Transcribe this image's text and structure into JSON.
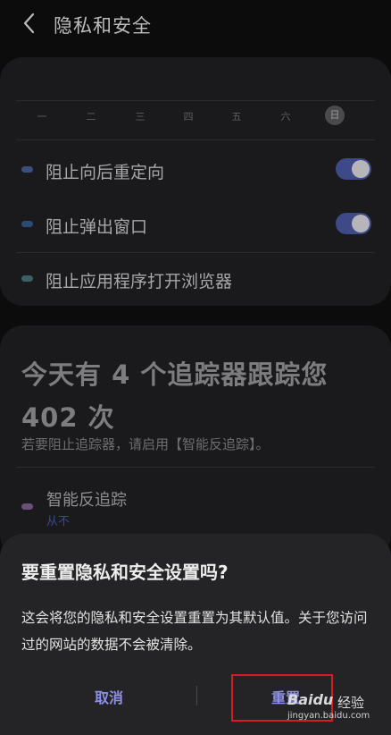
{
  "header": {
    "title": "隐私和安全"
  },
  "calendar": {
    "days": [
      "一",
      "二",
      "三",
      "四",
      "五",
      "六",
      "日"
    ],
    "today_index": 6
  },
  "settings": [
    {
      "label": "阻止向后重定向",
      "toggle": true,
      "dot_color": "#3a4f7a"
    },
    {
      "label": "阻止弹出窗口",
      "toggle": true,
      "dot_color": "#2e4a72"
    },
    {
      "label": "阻止应用程序打开浏览器",
      "toggle": false,
      "dot_color": "#3b5f65"
    }
  ],
  "tracker": {
    "headline_line1": "今天有 4 个追踪器跟踪您",
    "headline_line2": "402 次",
    "hint": "若要阻止追踪器，请启用【智能反追踪】。",
    "anti_tracking_label": "智能反追踪",
    "anti_tracking_status": "从不",
    "anti_tracking_dot_color": "#6b4f7a"
  },
  "dialog": {
    "title": "要重置隐私和安全设置吗?",
    "message": "这会将您的隐私和安全设置重置为其默认值。关于您访问过的网站的数据不会被清除。",
    "cancel_label": "取消",
    "reset_label": "重置"
  },
  "watermark": {
    "brand": "Baidu",
    "suffix": "经验",
    "url": "jingyan.baidu.com"
  },
  "colors": {
    "accent": "#8f8fe8",
    "toggle_on": "#3d4a87",
    "highlight_box": "#d61d24"
  }
}
